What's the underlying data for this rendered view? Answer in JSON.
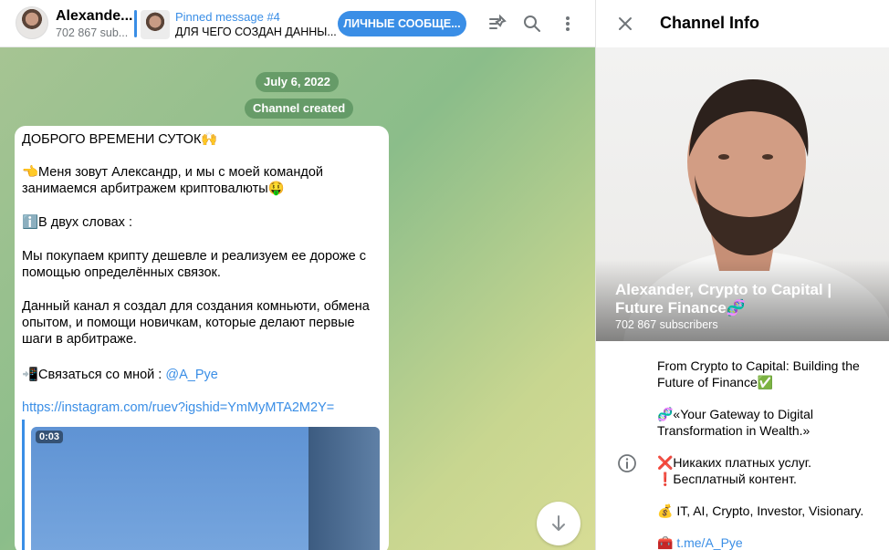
{
  "header": {
    "channel_name": "Alexande...",
    "subscribers": "702 867 sub...",
    "pinned_title": "Pinned message #4",
    "pinned_text": "ДЛЯ ЧЕГО СОЗДАН ДАННЫ...",
    "dm_button": "ЛИЧНЫЕ СООБЩЕ...",
    "icons": [
      "pinned-list-icon",
      "search-icon",
      "more-vertical-icon"
    ]
  },
  "chat": {
    "date_pill": "July 6, 2022",
    "service_pill": "Channel created",
    "message": {
      "line1": "ДОБРОГО ВРЕМЕНИ СУТОК🙌",
      "line2": "👈Меня зовут Александр, и мы с моей командой",
      "line3": "занимаемся арбитражем криптовалюты🤑",
      "line4": "ℹ️В двух словах :",
      "line5": "Мы покупаем крипту дешевле и реализуем ее дороже с",
      "line6": "помощью определённых связок.",
      "line7": "Данный канал я создал для создания комньюти, обмена",
      "line8": "опытом, и помощи новичкам, которые делают первые",
      "line9": "шаги в арбитраже.",
      "contact_prefix": "📲Связаться со мной : ",
      "contact_handle": "@A_Pye",
      "instagram_link": "https://instagram.com/ruev?igshid=YmMyMTA2M2Y=",
      "video_duration": "0:03"
    }
  },
  "info_panel": {
    "title": "Channel Info",
    "channel_full_name": "Alexander, Crypto to Capital | Future Finance🧬",
    "subscribers": "702 867 subscribers",
    "desc1": "From Crypto to Capital: Building the",
    "desc2": "Future of Finance✅",
    "desc3": "🧬«Your Gateway to Digital",
    "desc4": "Transformation in Wealth.»",
    "desc5": "❌Никаких платных услуг.",
    "desc6": "❗Бесплатный контент.",
    "desc7": "💰 IT, AI, Crypto, Investor, Visionary.",
    "desc8_prefix": "🧰 ",
    "desc8_link": "t.me/A_Pye"
  },
  "colors": {
    "accent": "#3a8ee6",
    "chat_bg_start": "#a6c493",
    "chat_bg_end": "#d7dc95"
  }
}
